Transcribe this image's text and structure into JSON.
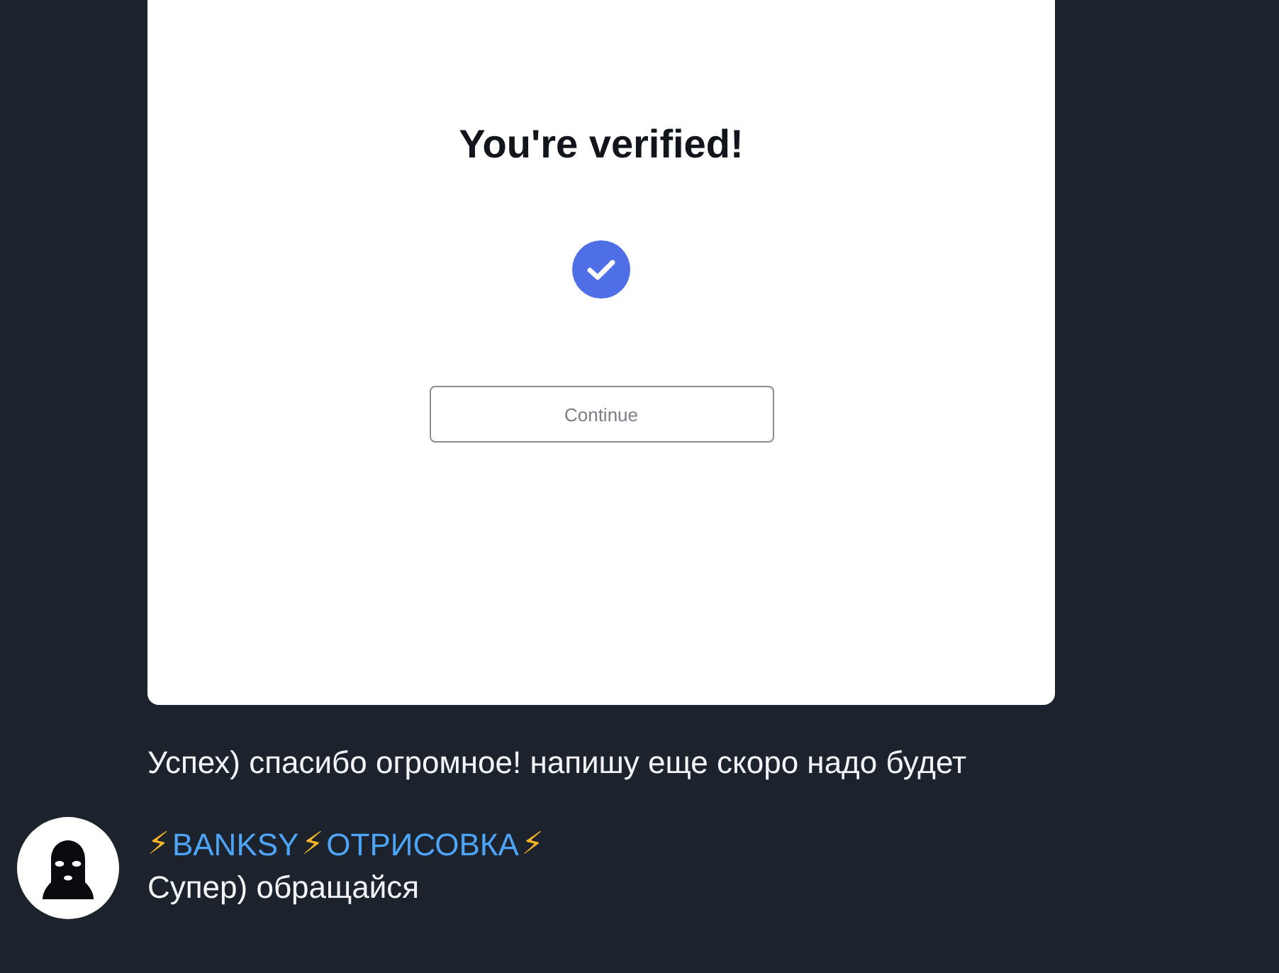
{
  "messages": [
    {
      "kind": "image",
      "image": {
        "heading": "You're verified!",
        "checked": true,
        "button": "Continue"
      }
    },
    {
      "kind": "text",
      "text": "Успех) спасибо огромное! напишу еще скоро надо будет"
    }
  ],
  "reply": {
    "sender": [
      {
        "kind": "emoji",
        "text": "⚡"
      },
      {
        "kind": "name",
        "text": "BANKSY"
      },
      {
        "kind": "emoji",
        "text": "⚡"
      },
      {
        "kind": "name",
        "text": "ОТРИСОВКА"
      },
      {
        "kind": "emoji",
        "text": "⚡"
      }
    ],
    "text": "Супер) обращайся"
  }
}
